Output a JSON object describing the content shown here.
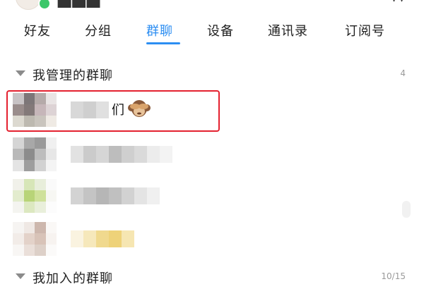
{
  "tabs": [
    {
      "label": "好友",
      "active": false
    },
    {
      "label": "分组",
      "active": false
    },
    {
      "label": "群聊",
      "active": true
    },
    {
      "label": "设备",
      "active": false
    },
    {
      "label": "通讯录",
      "active": false
    },
    {
      "label": "订阅号",
      "active": false
    }
  ],
  "colors": {
    "accent": "#2c8ef2",
    "highlight_box": "#e4212f",
    "online_dot": "#3cc76a"
  },
  "sections": {
    "managed": {
      "title": "我管理的群聊",
      "count": "4"
    },
    "joined": {
      "title": "我加入的群聊",
      "count": "10/15"
    }
  },
  "groups": [
    {
      "visible_name": "们",
      "name_icon": "monkey-see-no-evil-icon",
      "name_blurred": true,
      "avatar_blurred": true
    },
    {
      "visible_name": "",
      "name_blurred": true,
      "avatar_blurred": true
    },
    {
      "visible_name": "",
      "name_blurred": true,
      "avatar_blurred": true
    },
    {
      "visible_name": "",
      "name_blurred": true,
      "avatar_blurred": true
    }
  ]
}
